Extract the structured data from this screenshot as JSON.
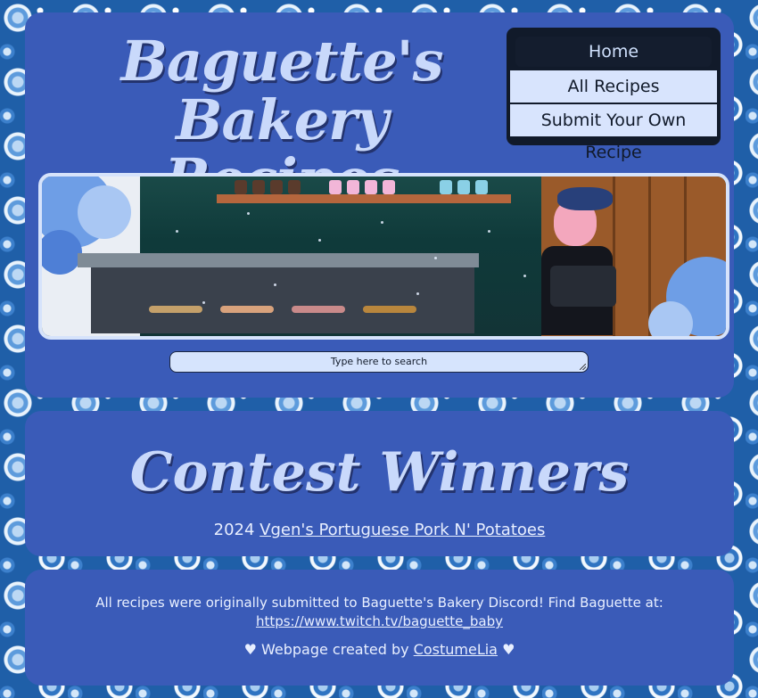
{
  "header": {
    "title_line1": "Baguette's Bakery",
    "title_line2": "Recipes"
  },
  "nav": {
    "items": [
      "Home",
      "All Recipes",
      "Submit Your Own Recipe"
    ],
    "active": "Home"
  },
  "search": {
    "placeholder": "Type here to search"
  },
  "contest": {
    "title": "Contest Winners",
    "year": "2024",
    "winner_link": "Vgen's Portuguese Pork N' Potatoes"
  },
  "footer": {
    "text": "All recipes were originally submitted to Baguette's Bakery Discord! Find Baguette at:",
    "twitch_link": "https://www.twitch.tv/baguette_baby",
    "credit_prefix": "♥ Webpage created by",
    "credit_link": "CostumeLia",
    "credit_suffix": "♥"
  },
  "colors": {
    "panel": "#3a5bb8",
    "title_text": "#c9d9fb",
    "nav_bg": "#111a2a",
    "nav_item": "#d8e4fd"
  }
}
